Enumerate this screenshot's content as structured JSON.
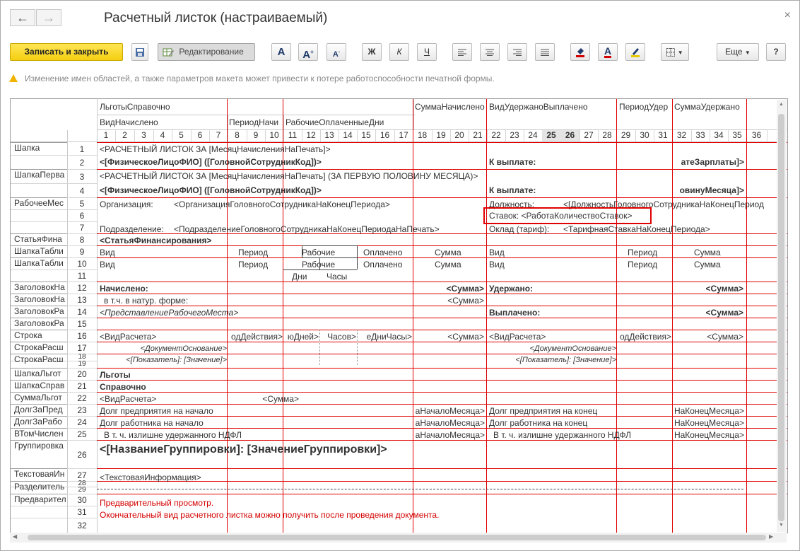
{
  "window": {
    "title": "Расчетный листок (настраиваемый)",
    "back_icon": "←",
    "forward_icon": "→",
    "close_icon": "×"
  },
  "toolbar": {
    "save_close_label": "Записать и закрыть",
    "edit_label": "Редактирование",
    "bold_label": "Ж",
    "italic_label": "К",
    "underline_label": "Ч",
    "more_label": "Еще",
    "help_label": "?",
    "font_a": "A"
  },
  "warning": {
    "text": "Изменение имен областей, а также параметров макета может привести к потере работоспособности печатной формы."
  },
  "sheet": {
    "col_group_headers": [
      "ЛьготыСправочно",
      "ВидНачислено",
      "ПериодНачи",
      "РабочиеОплаченныеДни",
      "СуммаНачислено",
      "ВидУдержаноВыплачено",
      "ПериодУдер",
      "СуммаУдержано"
    ],
    "column_numbers": [
      "1",
      "2",
      "3",
      "4",
      "5",
      "6",
      "7",
      "8",
      "9",
      "10",
      "11",
      "12",
      "13",
      "14",
      "15",
      "16",
      "17",
      "18",
      "19",
      "20",
      "21",
      "22",
      "23",
      "24",
      "25",
      "26",
      "27",
      "28",
      "29",
      "30",
      "31",
      "32",
      "33",
      "34",
      "35",
      "36"
    ],
    "row_names": [
      "Шапка",
      "ШапкаПерва",
      "РабочееМес",
      "СтатьяФина",
      "ШапкаТабли",
      "ШапкаТабли",
      "ЗаголовокНа",
      "ЗаголовокНа",
      "ЗаголовокРа",
      "ЗаголовокРа",
      "Строка",
      "СтрокаРасш",
      "СтрокаРасш",
      "ШапкаЛьгот",
      "ШапкаСправ",
      "СуммаЛьгот",
      "ДолгЗаПред",
      "ДолгЗаРабо",
      "ВТомЧислен",
      "Группировка",
      "ТекстоваяИн",
      "Разделитель",
      "Предварител"
    ],
    "row_numbers": [
      "1",
      "2",
      "3",
      "4",
      "5",
      "6",
      "7",
      "8",
      "9",
      "10",
      "11",
      "12",
      "13",
      "14",
      "15",
      "16",
      "17",
      "18",
      "19",
      "20",
      "21",
      "22",
      "23",
      "24",
      "25",
      "26",
      "27",
      "28",
      "29",
      "30",
      "31",
      "32"
    ],
    "cells": {
      "r1": "<РАСЧЕТНЫЙ ЛИСТОК ЗА [МесяцНачисленияНаПечать]>",
      "r2a": "<[ФизическоеЛицоФИО] ([ГоловнойСотрудникКод])>",
      "r2b": "К выплате:",
      "r2c": "атеЗарплаты]>",
      "r3": "<РАСЧЕТНЫЙ ЛИСТОК ЗА [МесяцНачисленияНаПечать] (ЗА ПЕРВУЮ ПОЛОВИНУ МЕСЯЦА)>",
      "r4a": "<[ФизическоеЛицоФИО] ([ГоловнойСотрудникКод])>",
      "r4b": "К выплате:",
      "r4c": "овинуМесяца]>",
      "r5a": "Организация:",
      "r5b": "<ОрганизацияГоловногоСотрудникаНаКонецПериода>",
      "r5c": "Должность:",
      "r5d": "<[ДолжностьГоловногоСотрудникаНаКонецПериод",
      "r6": "Ставок:  <РаботаКоличествоСтавок>",
      "r7a": "Подразделение:",
      "r7b": "<ПодразделениеГоловногоСотрудникаНаКонецПериодаНаПечать>",
      "r7c": "Оклад (тариф):",
      "r7d": "<ТарифнаяСтавкаНаКонецПериода>",
      "r8": "<СтатьяФинансирования>",
      "vid": "Вид",
      "period": "Период",
      "rabochie": "Рабочие",
      "oplacheno": "Оплачено",
      "summa": "Сумма",
      "dni": "Дни",
      "chasy": "Часы",
      "r12a": "Начислено:",
      "r12b": "<Сумма>",
      "r12c": "Удержано:",
      "r12d": "<Сумма>",
      "r13a": "в т.ч. в натур. форме:",
      "r13b": "<Сумма>",
      "r14a": "<ПредставлениеРабочегоМеста>",
      "r14b": "Выплачено:",
      "r14c": "<Сумма>",
      "r16a": "<ВидРасчета>",
      "r16b": "одДействия>",
      "r16c": "юДней>",
      "r16d": "Часов>",
      "r16e": "еДниЧасы>",
      "r16f": "<Сумма>",
      "r16g": "<ВидРасчета>",
      "r16h": "одДействия>",
      "r16i": "<Сумма>",
      "r17a": "<ДокументОснование>",
      "r17b": "<ДокументОснование>",
      "r18a": "<[Показатель]: [Значение]>",
      "r18b": "<[Показатель]: [Значение]>",
      "r20": "Льготы",
      "r21": "Справочно",
      "r22a": "<ВидРасчета>",
      "r22b": "<Сумма>",
      "r23a": "Долг предприятия на начало",
      "r23b": "аНачалоМесяца>",
      "r23c": "Долг предприятия на конец",
      "r23d": "НаКонецМесяца>",
      "r24a": "Долг работника на начало",
      "r24b": "аНачалоМесяца>",
      "r24c": "Долг работника на конец",
      "r24d": "НаКонецМесяца>",
      "r25a": "В т. ч. излишне удержанного НДФЛ",
      "r25b": "аНачалоМесяца>",
      "r25c": "В т. ч. излишне удержанного НДФЛ",
      "r25d": "НаКонецМесяца>",
      "r26": "<[НазваниеГруппировки]: [ЗначениеГруппировки]>",
      "r27": "<ТекстоваяИнформация>",
      "r30": "Предварительный просмотр.",
      "r31": "Окончательный вид расчетного листка можно получить после проведения документа."
    }
  },
  "colors": {
    "accent_yellow": "#f5cf10",
    "red_border": "#e00000",
    "highlight_box": "#e00000"
  }
}
